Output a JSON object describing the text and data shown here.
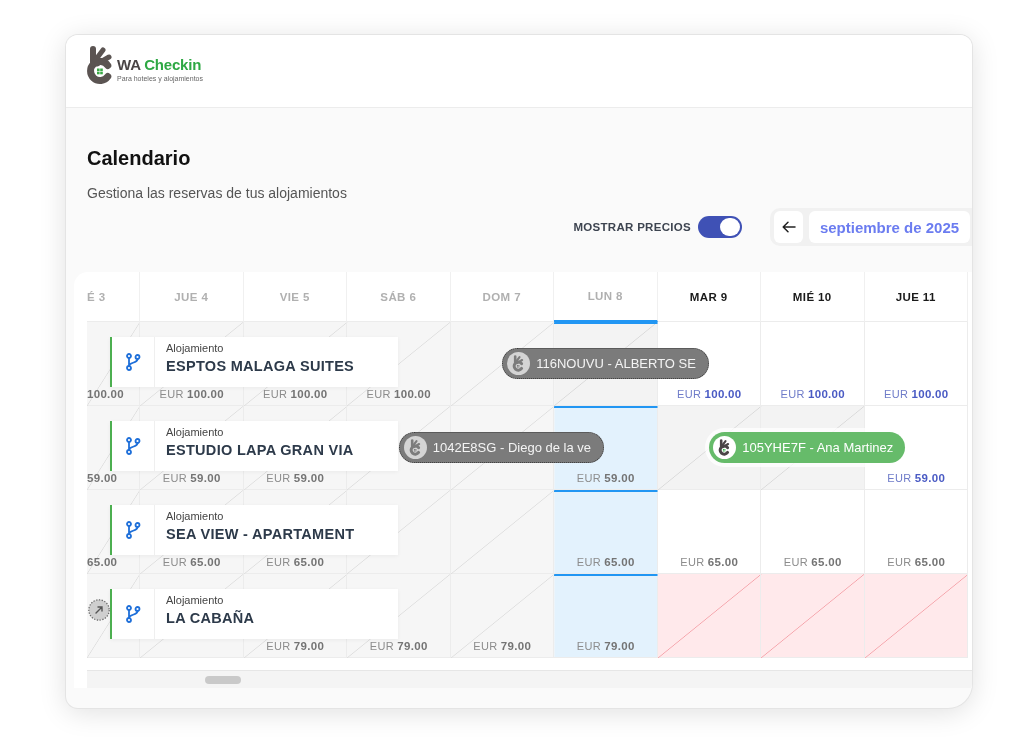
{
  "logo": {
    "prefix": "WA",
    "name": "Checkin",
    "tagline": "Para hoteles y alojamientos"
  },
  "page": {
    "title": "Calendario",
    "subtitle": "Gestiona las reservas de tus alojamientos"
  },
  "prices_toggle": {
    "label": "MOSTRAR PRECIOS",
    "on": true
  },
  "month_nav": {
    "month": "septiembre de 2025"
  },
  "calendar": {
    "columns": [
      {
        "label": "É 3",
        "muted": true,
        "today": false
      },
      {
        "label": "JUE 4",
        "muted": true,
        "today": false
      },
      {
        "label": "VIE 5",
        "muted": true,
        "today": false
      },
      {
        "label": "SÁB 6",
        "muted": true,
        "today": false
      },
      {
        "label": "DOM 7",
        "muted": true,
        "today": false
      },
      {
        "label": "LUN 8",
        "muted": true,
        "today": true
      },
      {
        "label": "MAR 9",
        "muted": false,
        "today": false
      },
      {
        "label": "MIÉ 10",
        "muted": false,
        "today": false
      },
      {
        "label": "JUE 11",
        "muted": false,
        "today": false
      }
    ],
    "rows": [
      {
        "type_label": "Alojamiento",
        "name": "ESPTOS MALAGA SUITES",
        "cells": [
          {
            "kind": "past",
            "price": {
              "amount": "100.00",
              "accent": false
            }
          },
          {
            "kind": "past",
            "price": {
              "currency": "EUR",
              "amount": "100.00",
              "accent": false
            }
          },
          {
            "kind": "past",
            "price": {
              "currency": "EUR",
              "amount": "100.00",
              "accent": false
            }
          },
          {
            "kind": "past",
            "price": {
              "currency": "EUR",
              "amount": "100.00",
              "accent": false
            }
          },
          {
            "kind": "past"
          },
          {
            "kind": "booked",
            "booking": {
              "cancelled": true,
              "label": "116NOUVU - ALBERTO SE"
            }
          },
          {
            "kind": "open",
            "price": {
              "currency": "EUR",
              "amount": "100.00",
              "accent": true
            }
          },
          {
            "kind": "open",
            "price": {
              "currency": "EUR",
              "amount": "100.00",
              "accent": true
            }
          },
          {
            "kind": "open",
            "price": {
              "currency": "EUR",
              "amount": "100.00",
              "accent": true
            }
          }
        ]
      },
      {
        "type_label": "Alojamiento",
        "name": "ESTUDIO LAPA GRAN VIA",
        "cells": [
          {
            "kind": "past",
            "price": {
              "amount": "59.00",
              "accent": false
            }
          },
          {
            "kind": "past",
            "price": {
              "currency": "EUR",
              "amount": "59.00",
              "accent": false
            }
          },
          {
            "kind": "past",
            "price": {
              "currency": "EUR",
              "amount": "59.00",
              "accent": false
            }
          },
          {
            "kind": "past"
          },
          {
            "kind": "past",
            "booking": {
              "cancelled": true,
              "label": "1042E8SG - Diego de la ve"
            }
          },
          {
            "kind": "open",
            "price": {
              "currency": "EUR",
              "amount": "59.00",
              "accent": false
            }
          },
          {
            "kind": "booked"
          },
          {
            "kind": "booked",
            "booking": {
              "cancelled": false,
              "label": "105YHE7F - Ana Martinez"
            }
          },
          {
            "kind": "open",
            "price": {
              "currency": "EUR",
              "amount": "59.00",
              "accent": true
            }
          }
        ]
      },
      {
        "type_label": "Alojamiento",
        "name": "SEA VIEW - APARTAMENT",
        "cells": [
          {
            "kind": "past",
            "price": {
              "amount": "65.00",
              "accent": false
            }
          },
          {
            "kind": "past",
            "price": {
              "currency": "EUR",
              "amount": "65.00",
              "accent": false
            }
          },
          {
            "kind": "past",
            "price": {
              "currency": "EUR",
              "amount": "65.00",
              "accent": false
            }
          },
          {
            "kind": "past"
          },
          {
            "kind": "past"
          },
          {
            "kind": "open",
            "price": {
              "currency": "EUR",
              "amount": "65.00",
              "accent": false
            }
          },
          {
            "kind": "open",
            "price": {
              "currency": "EUR",
              "amount": "65.00",
              "accent": false
            }
          },
          {
            "kind": "open",
            "price": {
              "currency": "EUR",
              "amount": "65.00",
              "accent": false
            }
          },
          {
            "kind": "open",
            "price": {
              "currency": "EUR",
              "amount": "65.00",
              "accent": false
            }
          }
        ]
      },
      {
        "type_label": "Alojamiento",
        "name": "LA CABAÑA",
        "cells": [
          {
            "kind": "past",
            "booking": {
              "cancelled": true
            }
          },
          {
            "kind": "past"
          },
          {
            "kind": "past",
            "price": {
              "currency": "EUR",
              "amount": "79.00",
              "accent": false
            }
          },
          {
            "kind": "past",
            "price": {
              "currency": "EUR",
              "amount": "79.00",
              "accent": false
            }
          },
          {
            "kind": "past",
            "price": {
              "currency": "EUR",
              "amount": "79.00",
              "accent": false
            }
          },
          {
            "kind": "open",
            "price": {
              "currency": "EUR",
              "amount": "79.00",
              "accent": false
            }
          },
          {
            "kind": "blocked"
          },
          {
            "kind": "blocked"
          },
          {
            "kind": "blocked"
          }
        ]
      }
    ]
  }
}
